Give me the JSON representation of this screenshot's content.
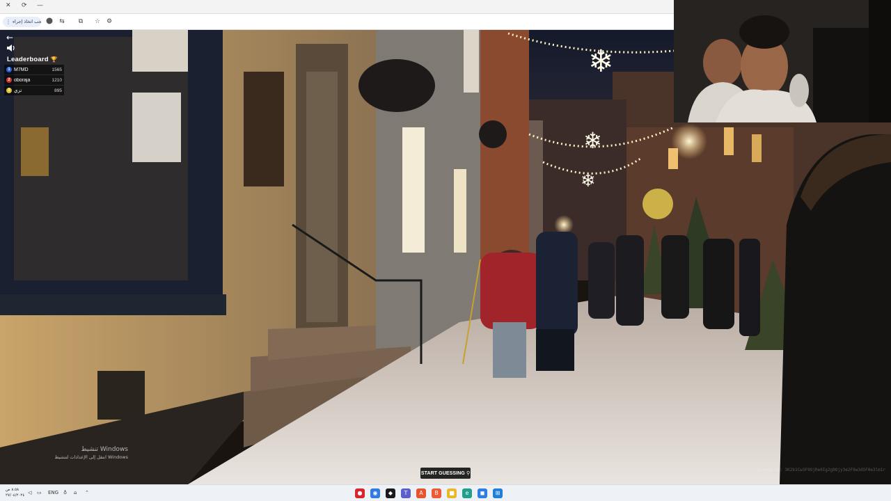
{
  "browser": {
    "address_chip_text": "يجب اتخاذ إجراء",
    "back_glyph": "←"
  },
  "window_controls": {
    "close": "✕",
    "restore": "⟳",
    "minimize": "—"
  },
  "game": {
    "leaderboard_title": "Leaderboard",
    "leaderboard": [
      {
        "rank": "1",
        "name": "M7MD",
        "score": "1565",
        "color": "#2a63d8"
      },
      {
        "rank": "2",
        "name": "oboraja",
        "score": "1210",
        "color": "#d8352a"
      },
      {
        "rank": "3",
        "name": "تزي",
        "score": "895",
        "color": "#e0c12a"
      }
    ],
    "start_button_label": "START GUESSING",
    "street_id_text": "Street ID: 3K2b1Cw3F9OjRe0Ig2g9Ojy3e2F9w3dSF0e3lm1r"
  },
  "windows_activation": {
    "title": "تنشيط Windows",
    "subtitle": "انتقل إلى الإعدادات لتنشيط Windows"
  },
  "taskbar": {
    "time": "٨:٥٨ ص",
    "date": "٢٧/٠٤/٢٠٢٤",
    "language": "ENG",
    "apps": [
      {
        "name": "game-app",
        "glyph": "●",
        "color": "#d9262b"
      },
      {
        "name": "chrome-app",
        "glyph": "◉",
        "color": "#2f7be0"
      },
      {
        "name": "media-app",
        "glyph": "◆",
        "color": "#1a1a1a"
      },
      {
        "name": "teams-app",
        "glyph": "T",
        "color": "#5b5fc7"
      },
      {
        "name": "pdf-app",
        "glyph": "A",
        "color": "#e8532b"
      },
      {
        "name": "brave-app",
        "glyph": "B",
        "color": "#ef5a35"
      },
      {
        "name": "explorer-app",
        "glyph": "■",
        "color": "#e9b82a"
      },
      {
        "name": "edge-app",
        "glyph": "e",
        "color": "#1f9f8c"
      },
      {
        "name": "store-app",
        "glyph": "◼",
        "color": "#2d7fe0"
      },
      {
        "name": "start-app",
        "glyph": "⊞",
        "color": "#1e7fd8"
      }
    ]
  }
}
